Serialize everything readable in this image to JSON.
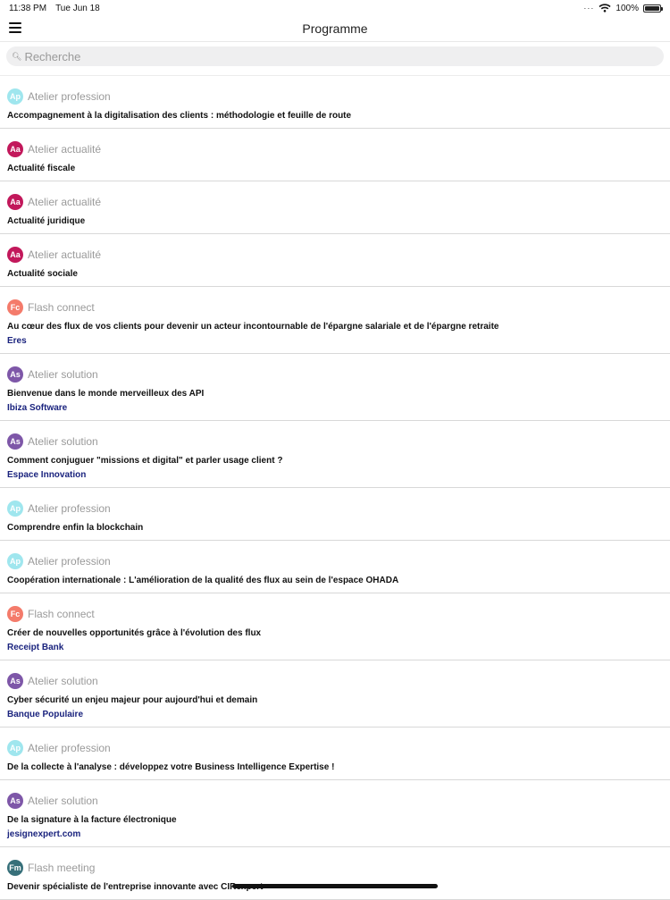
{
  "status_bar": {
    "time": "11:38 PM",
    "date": "Tue Jun 18",
    "battery": "100%",
    "battery_level": 1.0
  },
  "nav": {
    "title": "Programme"
  },
  "search": {
    "placeholder": "Recherche"
  },
  "colors": {
    "Ap": "#9fe6ee",
    "Aa": "#c2185b",
    "Fc": "#f47b6b",
    "As": "#7e57a8",
    "Fm": "#37707a",
    "sponsor": "#1a237e"
  },
  "sessions": [
    {
      "badge": "Ap",
      "type": "Atelier profession",
      "title": "Accompagnement à la digitalisation des clients : méthodologie et feuille de route",
      "sponsor": ""
    },
    {
      "badge": "Aa",
      "type": "Atelier actualité",
      "title": "Actualité fiscale",
      "sponsor": ""
    },
    {
      "badge": "Aa",
      "type": "Atelier actualité",
      "title": "Actualité juridique",
      "sponsor": ""
    },
    {
      "badge": "Aa",
      "type": "Atelier actualité",
      "title": "Actualité sociale",
      "sponsor": ""
    },
    {
      "badge": "Fc",
      "type": "Flash connect",
      "title": "Au cœur des flux de vos clients pour devenir un acteur incontournable de l'épargne salariale et de l'épargne retraite",
      "sponsor": "Eres"
    },
    {
      "badge": "As",
      "type": "Atelier solution",
      "title": "Bienvenue dans le monde merveilleux des API",
      "sponsor": "Ibiza Software"
    },
    {
      "badge": "As",
      "type": "Atelier solution",
      "title": "Comment conjuguer \"missions et digital\" et parler usage client ?",
      "sponsor": "Espace Innovation"
    },
    {
      "badge": "Ap",
      "type": "Atelier profession",
      "title": "Comprendre enfin la blockchain",
      "sponsor": ""
    },
    {
      "badge": "Ap",
      "type": "Atelier profession",
      "title": "Coopération internationale : L'amélioration de la qualité des flux au sein de l'espace OHADA",
      "sponsor": ""
    },
    {
      "badge": "Fc",
      "type": "Flash connect",
      "title": "Créer de nouvelles opportunités grâce à l'évolution des flux",
      "sponsor": "Receipt Bank"
    },
    {
      "badge": "As",
      "type": "Atelier solution",
      "title": "Cyber sécurité un enjeu majeur pour aujourd'hui et demain",
      "sponsor": "Banque Populaire"
    },
    {
      "badge": "Ap",
      "type": "Atelier profession",
      "title": "De la collecte à l'analyse : développez votre Business Intelligence Expertise !",
      "sponsor": ""
    },
    {
      "badge": "As",
      "type": "Atelier solution",
      "title": "De la signature à la facture électronique",
      "sponsor": "jesignexpert.com"
    },
    {
      "badge": "Fm",
      "type": "Flash meeting",
      "title": "Devenir spécialiste de l'entreprise innovante avec CIRexpert",
      "sponsor": ""
    }
  ]
}
